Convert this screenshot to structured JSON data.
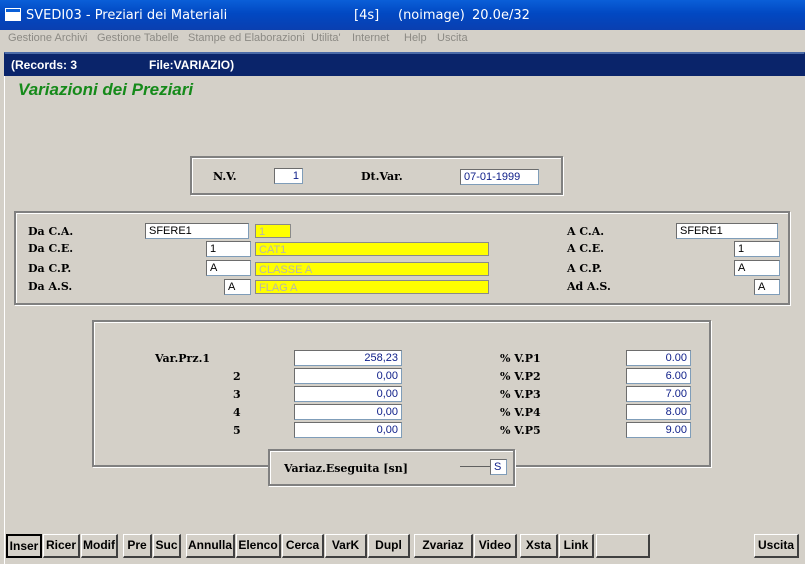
{
  "window": {
    "title": "SVEDI03 - Preziari dei Materiali",
    "status_code": "[4s]",
    "image_state": "(noimage)",
    "version": "20.0e/32"
  },
  "menu": [
    "Gestione Archivi",
    "Gestione Tabelle",
    "Stampe ed Elaborazioni",
    "Utilita'",
    "Internet",
    "Help",
    "Uscita"
  ],
  "infobar": {
    "records": "(Records: 3",
    "file": "File:VARIAZIO)"
  },
  "form_title": "Variazioni dei Preziari",
  "header": {
    "nv_label": "N.V.",
    "nv_value": "1",
    "dtvar_label": "Dt.Var.",
    "dtvar_value": "07-01-1999"
  },
  "range": {
    "da_ca_label": "Da C.A.",
    "da_ca_value": "SFERE1",
    "da_ca_desc": "1",
    "da_ce_label": "Da C.E.",
    "da_ce_value": "1",
    "da_ce_desc": "CAT1",
    "da_cp_label": "Da C.P.",
    "da_cp_value": "A",
    "da_cp_desc": "CLASSE A",
    "da_as_label": "Da A.S.",
    "da_as_value": "A",
    "da_as_desc": "FLAG A",
    "a_ca_label": "A C.A.",
    "a_ca_value": "SFERE1",
    "a_ce_label": "A C.E.",
    "a_ce_value": "1",
    "a_cp_label": "A C.P.",
    "a_cp_value": "A",
    "ad_as_label": "Ad A.S.",
    "ad_as_value": "A"
  },
  "variations": {
    "rows": [
      {
        "label": "Var.Prz.1",
        "value": "258,23",
        "pct_label": "% V.P1",
        "pct_value": "0.00"
      },
      {
        "label": "2",
        "value": "0,00",
        "pct_label": "% V.P2",
        "pct_value": "6.00"
      },
      {
        "label": "3",
        "value": "0,00",
        "pct_label": "% V.P3",
        "pct_value": "7.00"
      },
      {
        "label": "4",
        "value": "0,00",
        "pct_label": "% V.P4",
        "pct_value": "8.00"
      },
      {
        "label": "5",
        "value": "0,00",
        "pct_label": "% V.P5",
        "pct_value": "9.00"
      }
    ],
    "eseguita_label": "Variaz.Eseguita [sn]",
    "eseguita_value": "S"
  },
  "toolbar": {
    "inser": "Inser",
    "ricer": "Ricer",
    "modif": "Modif",
    "pre": "Pre",
    "suc": "Suc",
    "annulla": "Annulla",
    "elenco": "Elenco",
    "cerca": "Cerca",
    "vark": "VarK",
    "dupl": "Dupl",
    "zvariaz": "Zvariaz",
    "video": "Video",
    "xsta": "Xsta",
    "link": "Link",
    "uscita": "Uscita"
  }
}
